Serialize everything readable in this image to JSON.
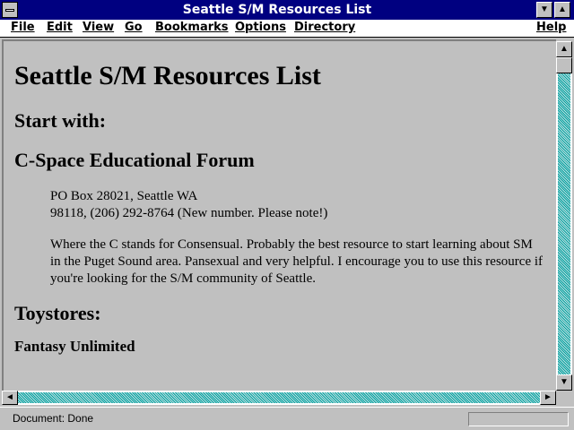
{
  "window": {
    "title": "Seattle S/M Resources List",
    "minimize_glyph": "▼",
    "maximize_glyph": "▲"
  },
  "menu": {
    "items": [
      {
        "label": "File"
      },
      {
        "label": "Edit"
      },
      {
        "label": "View"
      },
      {
        "label": "Go"
      },
      {
        "label": "Bookmarks"
      },
      {
        "label": "Options"
      },
      {
        "label": "Directory"
      },
      {
        "label": "Help"
      }
    ]
  },
  "page": {
    "heading": "Seattle S/M Resources List",
    "start_heading": "Start with:",
    "forum_heading": "C-Space Educational Forum",
    "address_line1": "PO Box 28021, Seattle WA",
    "address_line2": "98118, (206) 292-8764 (New number. Please note!)",
    "description": "Where the C stands for Consensual. Probably the best resource to start learning about SM in the Puget Sound area. Pansexual and very helpful. I encourage you to use this resource if you're looking for the S/M community of Seattle.",
    "toystores_heading": "Toystores:",
    "store_heading": "Fantasy Unlimited"
  },
  "scrollbars": {
    "up_glyph": "▲",
    "down_glyph": "▼",
    "left_glyph": "◄",
    "right_glyph": "►"
  },
  "status": {
    "text": "Document: Done",
    "progress": 0
  },
  "colors": {
    "titlebar": "#000080",
    "window_bg": "#c0c0c0"
  }
}
